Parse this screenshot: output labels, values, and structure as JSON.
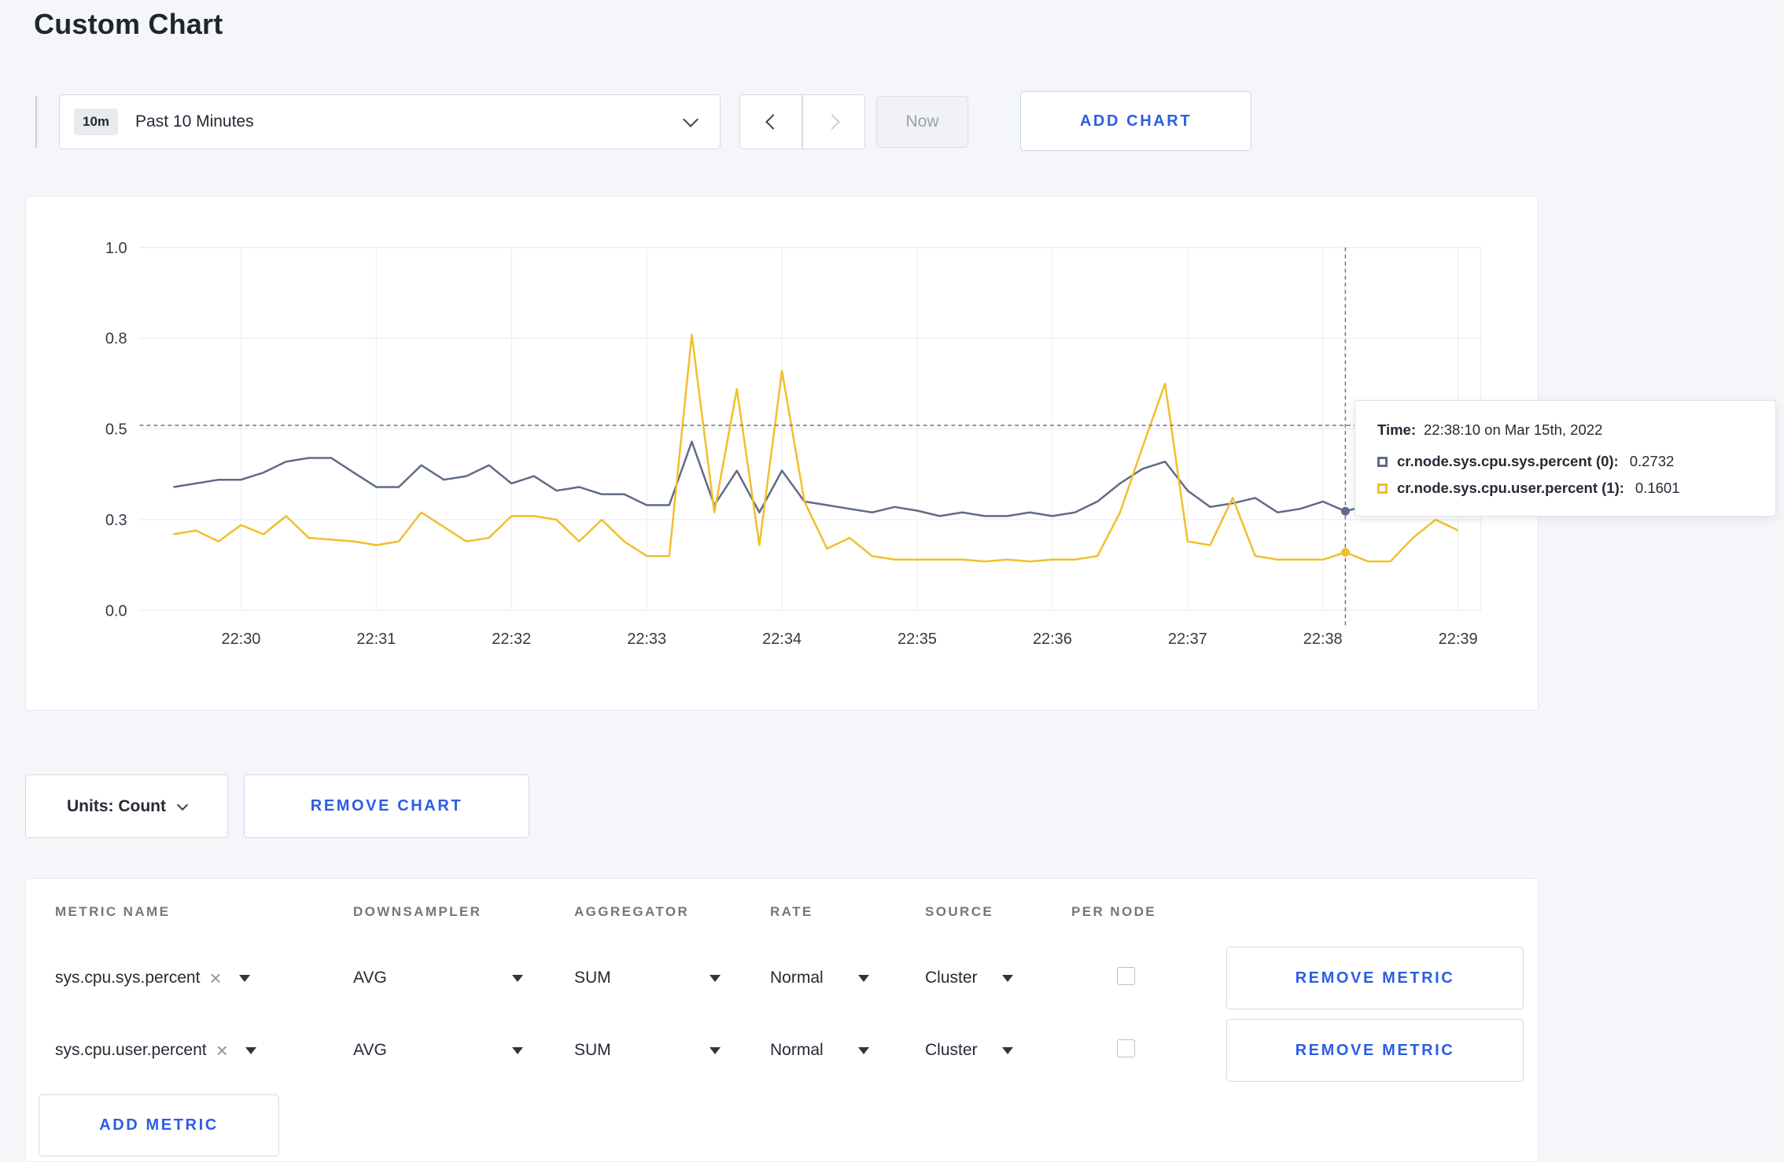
{
  "page": {
    "title": "Custom Chart"
  },
  "toolbar": {
    "time_window_badge": "10m",
    "time_window_label": "Past 10 Minutes",
    "now_label": "Now",
    "add_chart_label": "ADD CHART"
  },
  "chart_data": {
    "type": "line",
    "title": "",
    "xlabel": "",
    "ylabel": "",
    "ylim": [
      0,
      1
    ],
    "grid": true,
    "legend_position": "none",
    "y_tick_values": [
      0,
      0.25,
      0.5,
      0.75,
      1.0
    ],
    "y_tick_labels": [
      "0.0",
      "0.3",
      "0.5",
      "0.8",
      "1.0"
    ],
    "x_tick_labels": [
      "22:30",
      "22:31",
      "22:32",
      "22:33",
      "22:34",
      "22:35",
      "22:36",
      "22:37",
      "22:38",
      "22:39"
    ],
    "x_start_time": "22:29:30",
    "x_step_seconds": 10,
    "series": [
      {
        "name": "cr.node.sys.cpu.sys.percent",
        "color": "#5F6C87",
        "values": [
          0.34,
          0.35,
          0.36,
          0.36,
          0.38,
          0.41,
          0.42,
          0.42,
          0.38,
          0.34,
          0.34,
          0.4,
          0.36,
          0.37,
          0.4,
          0.35,
          0.37,
          0.33,
          0.34,
          0.32,
          0.32,
          0.29,
          0.29,
          0.465,
          0.29,
          0.385,
          0.27,
          0.385,
          0.3,
          0.29,
          0.28,
          0.27,
          0.285,
          0.275,
          0.26,
          0.27,
          0.26,
          0.26,
          0.27,
          0.26,
          0.27,
          0.3,
          0.35,
          0.39,
          0.41,
          0.33,
          0.285,
          0.295,
          0.31,
          0.27,
          0.28,
          0.3,
          0.2732,
          0.29,
          0.3,
          0.295,
          0.295,
          0.31
        ]
      },
      {
        "name": "cr.node.sys.cpu.user.percent",
        "color": "#F2BE2C",
        "values": [
          0.21,
          0.22,
          0.19,
          0.235,
          0.21,
          0.26,
          0.2,
          0.195,
          0.19,
          0.18,
          0.19,
          0.27,
          0.23,
          0.19,
          0.2,
          0.26,
          0.26,
          0.25,
          0.19,
          0.25,
          0.19,
          0.15,
          0.15,
          0.76,
          0.27,
          0.61,
          0.18,
          0.66,
          0.3,
          0.17,
          0.2,
          0.15,
          0.14,
          0.14,
          0.14,
          0.14,
          0.135,
          0.14,
          0.135,
          0.14,
          0.14,
          0.15,
          0.27,
          0.45,
          0.625,
          0.19,
          0.18,
          0.31,
          0.15,
          0.14,
          0.14,
          0.14,
          0.1601,
          0.135,
          0.135,
          0.2,
          0.25,
          0.22
        ]
      }
    ],
    "crosshair": {
      "point_index": 52,
      "mouse_value": 0.51,
      "time": "22:38:10"
    }
  },
  "tooltip": {
    "time_label": "Time:",
    "time_value": "22:38:10 on Mar 15th, 2022",
    "rows": [
      {
        "name": "cr.node.sys.cpu.sys.percent (0):",
        "value": "0.2732",
        "color": "#5F6C87"
      },
      {
        "name": "cr.node.sys.cpu.user.percent (1):",
        "value": "0.1601",
        "color": "#F2BE2C"
      }
    ]
  },
  "chart_controls": {
    "units_label": "Units: Count",
    "remove_chart_label": "REMOVE CHART"
  },
  "metrics_table": {
    "headers": [
      "METRIC NAME",
      "DOWNSAMPLER",
      "AGGREGATOR",
      "RATE",
      "SOURCE",
      "PER NODE"
    ],
    "rows": [
      {
        "metric": "sys.cpu.sys.percent",
        "downsampler": "AVG",
        "aggregator": "SUM",
        "rate": "Normal",
        "source": "Cluster",
        "per_node": false,
        "remove_label": "REMOVE METRIC"
      },
      {
        "metric": "sys.cpu.user.percent",
        "downsampler": "AVG",
        "aggregator": "SUM",
        "rate": "Normal",
        "source": "Cluster",
        "per_node": false,
        "remove_label": "REMOVE METRIC"
      }
    ],
    "add_metric_label": "ADD METRIC"
  },
  "icons": {
    "clear_icon": "×"
  },
  "colors": {
    "accent_blue": "#2c5de5",
    "series_sys": "#5F6C87",
    "series_user": "#F2BE2C",
    "page_background": "#f5f6fa"
  }
}
